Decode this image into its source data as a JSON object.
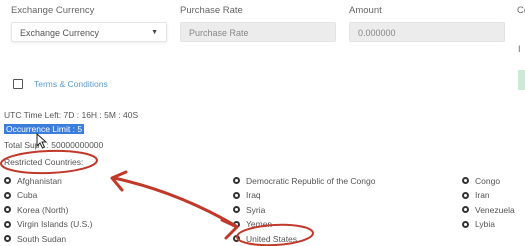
{
  "form": {
    "exchange_currency_label": "Exchange Currency",
    "exchange_currency_value": "Exchange Currency",
    "purchase_rate_label": "Purchase Rate",
    "purchase_rate_placeholder": "Purchase Rate",
    "amount_label": "Amount",
    "amount_value": "0.000000",
    "cut_label": "Co",
    "cut_side_char": "I"
  },
  "terms": {
    "label": "Terms & Conditions",
    "checked": false
  },
  "info": {
    "time_left": "UTC Time Left: 7D : 16H : 5M : 40S",
    "occurrence_limit": "Occurrence Limit : 5",
    "total_supply": "Total Sup   : 50000000000",
    "restricted_heading": "Restricted Countries:"
  },
  "restricted_countries": {
    "col1": [
      "Afghanistan",
      "Cuba",
      "Korea (North)",
      "Virgin Islands (U.S.)",
      "South Sudan"
    ],
    "col2": [
      "Democratic Republic of the Congo",
      "Iraq",
      "Syria",
      "Yemen",
      "United States"
    ],
    "col3": [
      "Congo",
      "Iran",
      "Venezuela",
      "Lybia"
    ]
  },
  "annotations": {
    "color": "#c0392b"
  },
  "colors": {
    "link": "#5b9bd5",
    "highlight": "#3b7ddc",
    "annotation_red": "#c0392b"
  }
}
